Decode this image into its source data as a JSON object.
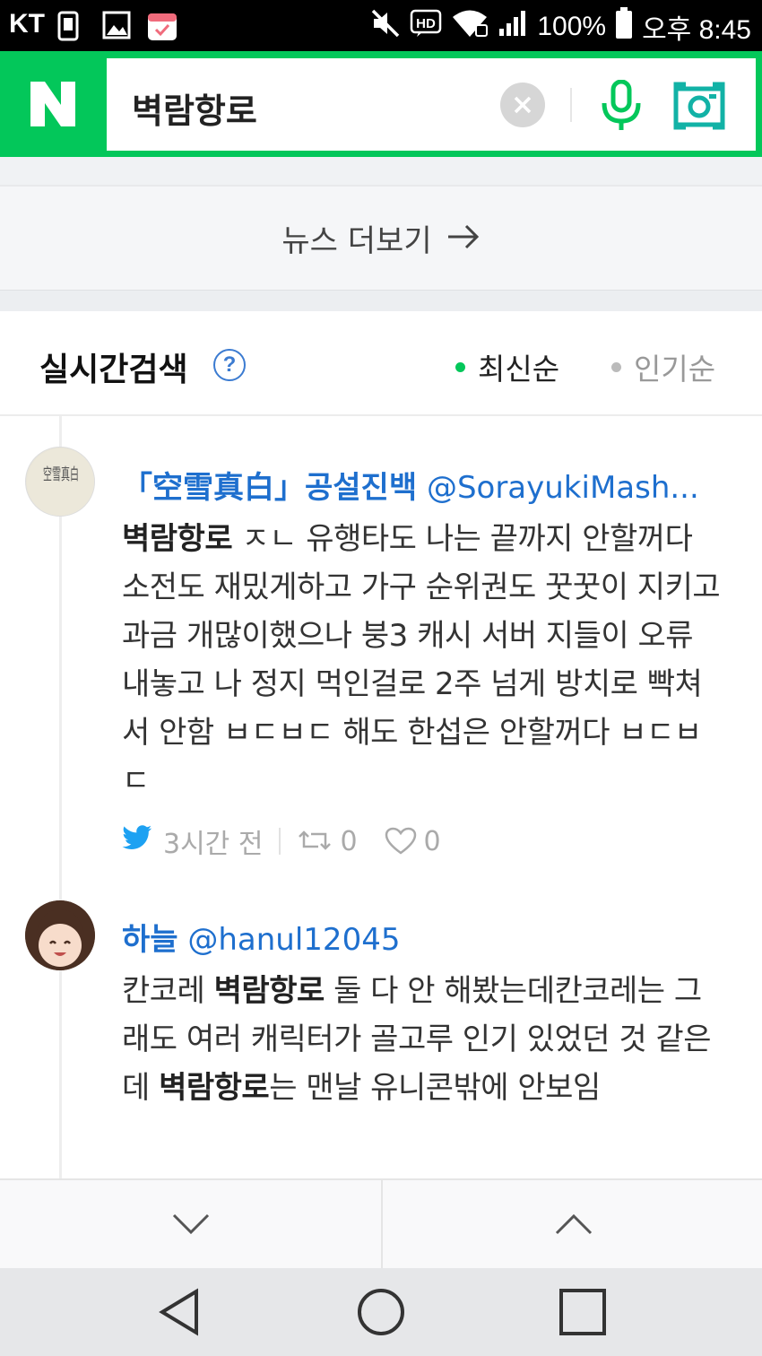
{
  "status_bar": {
    "carrier": "KT",
    "battery": "100%",
    "time": "오후 8:45",
    "hd_label": "HD",
    "icons": [
      "sim-card-icon",
      "gallery-icon",
      "calendar-icon",
      "mute-icon",
      "hd-voice-icon",
      "wifi-icon",
      "signal-icon",
      "battery-icon"
    ]
  },
  "search": {
    "logo": "N",
    "query": "벽람항로",
    "brand_color": "#03c75a"
  },
  "news_more": {
    "label": "뉴스 더보기"
  },
  "realtime": {
    "title": "실시간검색",
    "help_symbol": "?",
    "sort_latest": "최신순",
    "sort_popular": "인기순",
    "active_sort": "최신순",
    "active_color": "#03c75a"
  },
  "posts": [
    {
      "name": "「空雪真白」공설진백",
      "handle": "@SorayukiMash...",
      "avatar_text": "空雪真白",
      "body_parts": [
        {
          "t": "벽람항로",
          "b": true
        },
        {
          "t": " ㅈㄴ 유행타도 나는 끝까지 안할꺼다 소전도 재밌게하고 가구 순위권도 꿋꿋이 지키고 과금 개많이했으나 붕3 캐시 서버 지들이 오류 내놓고 나 정지 먹인걸로 2주 넘게 방치로 빡쳐서 안함 ㅂㄷㅂㄷ 해도 한섭은 안할꺼다 ㅂㄷㅂㄷ",
          "b": false
        }
      ],
      "time": "3시간 전",
      "retweets": "0",
      "likes": "0"
    },
    {
      "name": "하늘",
      "handle": "@hanul12045",
      "body_parts": [
        {
          "t": "칸코레 ",
          "b": false
        },
        {
          "t": "벽람항로",
          "b": true
        },
        {
          "t": " 둘 다 안 해봤는데칸코레는 그래도 여러 캐릭터가 골고루 인기 있었던 것 같은데 ",
          "b": false
        },
        {
          "t": "벽람항로",
          "b": true
        },
        {
          "t": "는 맨날 유니콘밖에 안보임",
          "b": false
        }
      ]
    }
  ],
  "link_color": "#1e6fce"
}
